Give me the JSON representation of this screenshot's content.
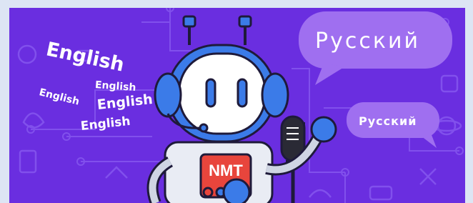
{
  "illustration": {
    "english_words": [
      "English",
      "English",
      "English",
      "English",
      "English"
    ],
    "russian_large": "Русский",
    "russian_small": "Русский",
    "robot_chest_label": "NMT"
  },
  "colors": {
    "background": "#6a2ee0",
    "bubble": "#9f6ff0",
    "robot_blue": "#3b7be8",
    "chest_red": "#e8453c",
    "outline": "#1e1a3a"
  }
}
